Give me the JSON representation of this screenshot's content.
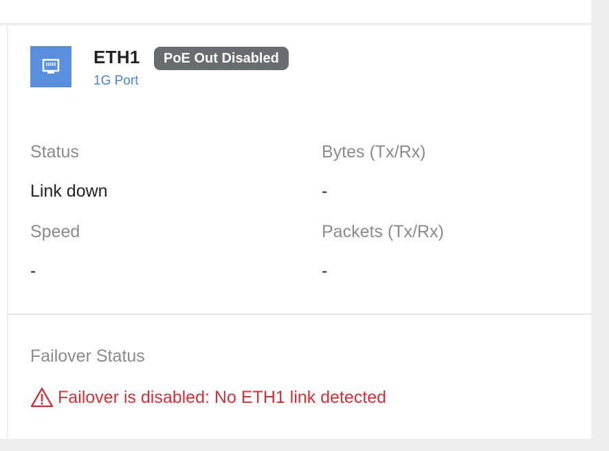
{
  "port": {
    "name": "ETH1",
    "badge": "PoE Out Disabled",
    "subtitle": "1G Port",
    "icon": "ethernet-port-icon",
    "icon_color": "#5a8fde"
  },
  "stats": {
    "status_label": "Status",
    "status_value": "Link down",
    "speed_label": "Speed",
    "speed_value": "-",
    "bytes_label": "Bytes (Tx/Rx)",
    "bytes_value": "-",
    "packets_label": "Packets (Tx/Rx)",
    "packets_value": "-"
  },
  "failover": {
    "label": "Failover Status",
    "message": "Failover is disabled: No ETH1 link detected",
    "icon": "warning-icon",
    "color": "#d0323a"
  }
}
